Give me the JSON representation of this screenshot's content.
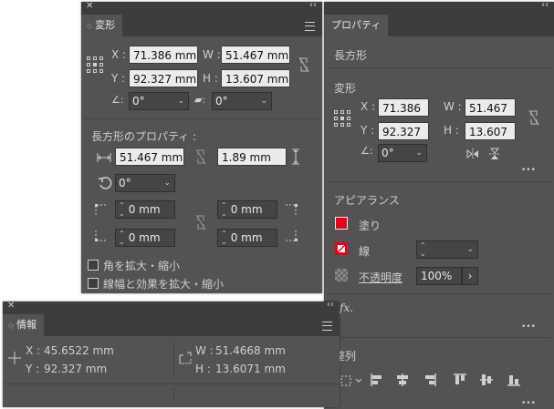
{
  "transform_panel": {
    "close_glyph": "✕",
    "collapse_glyph": "‹‹",
    "tab_label": "変形",
    "x_label": "X :",
    "x_value": "71.386 mm",
    "y_label": "Y :",
    "y_value": "92.327 mm",
    "w_label": "W :",
    "w_value": "51.467 mm",
    "h_label": "H :",
    "h_value": "13.607 mm",
    "rotate_value": "0°",
    "shear_value": "0°",
    "rect_props_title": "長方形のプロパティ :",
    "rect_width": "51.467 mm",
    "rect_height": "1.89 mm",
    "rect_rotate": "0°",
    "corner_tl": "0 mm",
    "corner_tr": "0 mm",
    "corner_bl": "0 mm",
    "corner_br": "0 mm",
    "scale_corners_label": "角を拡大・縮小",
    "scale_strokes_label": "線幅と効果を拡大・縮小"
  },
  "info_panel": {
    "close_glyph": "✕",
    "collapse_glyph": "‹‹",
    "tab_label": "情報",
    "x_label": "X :",
    "x_value": "45.6522 mm",
    "y_label": "Y :",
    "y_value": "92.327 mm",
    "w_label": "W :",
    "w_value": "51.4668 mm",
    "h_label": "H :",
    "h_value": "13.6071 mm"
  },
  "properties_panel": {
    "collapse_glyph": "‹‹",
    "tab_label": "プロパティ",
    "object_type": "長方形",
    "transform_title": "変形",
    "x_label": "X :",
    "x_value": "71.386",
    "y_label": "Y :",
    "y_value": "92.327",
    "w_label": "W :",
    "w_value": "51.467",
    "h_label": "H :",
    "h_value": "13.607",
    "rotate_value": "0°",
    "more_glyph": "•••",
    "appearance_title": "アピアランス",
    "fill_label": "塗り",
    "stroke_label": "線",
    "opacity_label": "不透明度",
    "opacity_value": "100%",
    "fx_label": "fx.",
    "align_title": "整列",
    "fill_color": "#e8001c",
    "stroke_color": "#e8001c"
  }
}
